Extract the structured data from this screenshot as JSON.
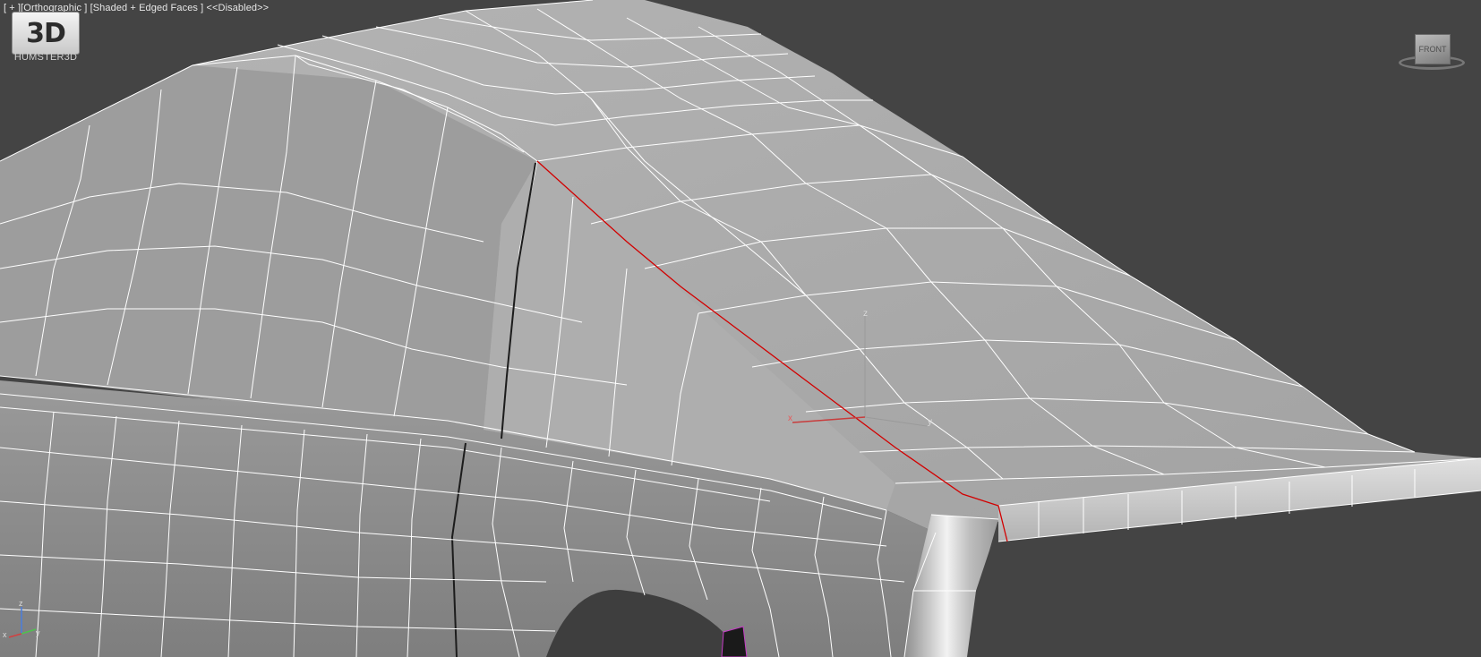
{
  "viewport": {
    "label_plus": "[ + ]",
    "label_view": "[Orthographic ]",
    "label_shading": "[Shaded + Edged Faces ]",
    "label_status": "<<Disabled>>"
  },
  "logo": {
    "mark": "3D",
    "caption": "HUMSTER3D"
  },
  "viewcube": {
    "face_label": "FRONT"
  },
  "gizmo": {
    "x_label": "x",
    "y_label": "y",
    "z_label": "z"
  },
  "corner_axes": {
    "x_label": "x",
    "y_label": "y",
    "z_label": "z"
  },
  "colors": {
    "background": "#444444",
    "mesh_base": "#a6a6a6",
    "wireframe": "#ffffff",
    "selected_edge": "#d20000",
    "gizmo_x": "#c83c3c",
    "gizmo_y": "#9a9a9a",
    "gizmo_z": "#9a9a9a"
  }
}
